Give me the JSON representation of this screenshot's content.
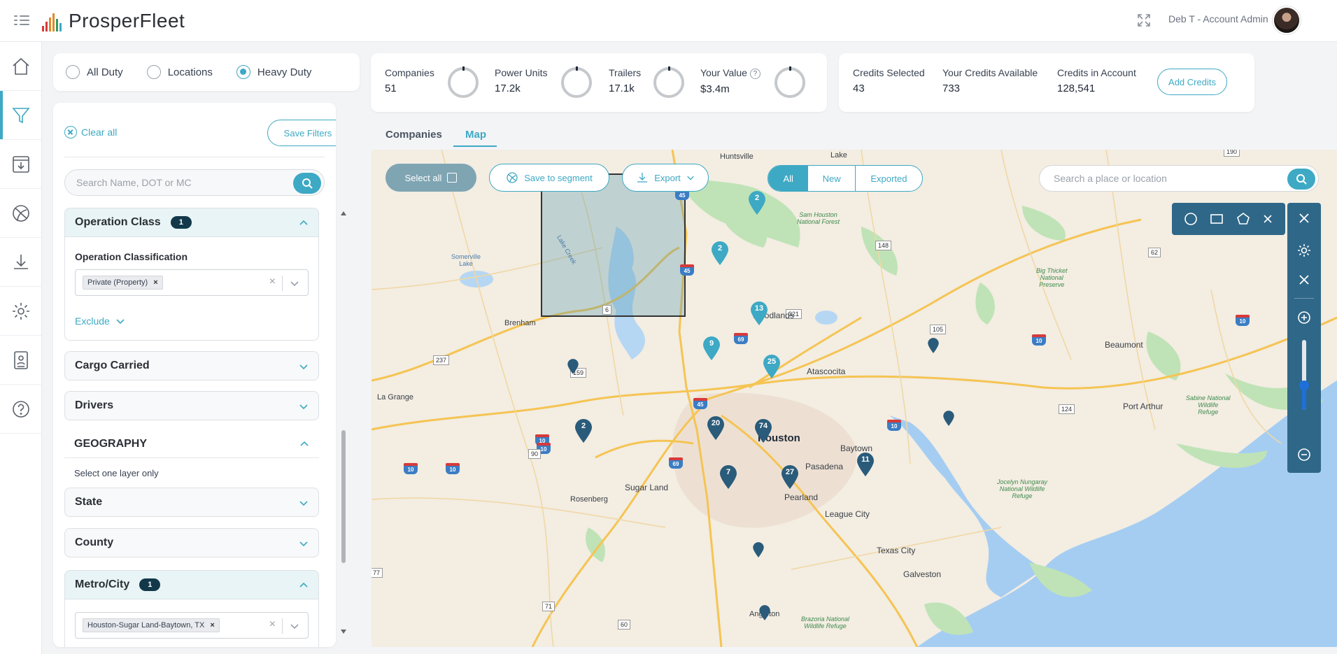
{
  "app": {
    "brand": "ProsperFleet",
    "account_label": "Deb T - Account Admin",
    "brand_colors": [
      "#d63a3a",
      "#e08a2a",
      "#3ea9c4",
      "#2f9d63"
    ]
  },
  "nav": {
    "items": [
      {
        "icon": "home-icon"
      },
      {
        "icon": "filter-icon",
        "active": true
      },
      {
        "icon": "save-download-icon"
      },
      {
        "icon": "segment-icon"
      },
      {
        "icon": "download-icon"
      },
      {
        "icon": "gear-icon"
      },
      {
        "icon": "contact-card-icon"
      },
      {
        "icon": "help-icon"
      }
    ]
  },
  "duty": {
    "options": [
      "All Duty",
      "Locations",
      "Heavy Duty"
    ],
    "selected": "Heavy Duty"
  },
  "stats": {
    "companies": {
      "label": "Companies",
      "value": "51"
    },
    "power_units": {
      "label": "Power Units",
      "value": "17.2k"
    },
    "trailers": {
      "label": "Trailers",
      "value": "17.1k"
    },
    "your_value": {
      "label": "Your Value",
      "value": "$3.4m",
      "help": "?"
    }
  },
  "credits": {
    "selected": {
      "label": "Credits Selected",
      "value": "43"
    },
    "available": {
      "label": "Your Credits Available",
      "value": "733"
    },
    "in_account": {
      "label": "Credits in Account",
      "value": "128,541"
    },
    "add_label": "Add Credits"
  },
  "filters": {
    "clear_all": "Clear all",
    "save_filters": "Save Filters",
    "search_placeholder": "Search Name, DOT or MC",
    "operation_class": {
      "title": "Operation Class",
      "badge": "1",
      "sub_label": "Operation Classification",
      "chip": "Private (Property)",
      "chip_remove": "×",
      "clear": "×",
      "exclude": "Exclude"
    },
    "cargo_carried": "Cargo Carried",
    "drivers": "Drivers",
    "geography": {
      "title": "GEOGRAPHY",
      "hint": "Select one layer only"
    },
    "state": "State",
    "county": "County",
    "metro": {
      "title": "Metro/City",
      "badge": "1",
      "chip": "Houston-Sugar Land-Baytown, TX",
      "chip_remove": "×",
      "clear": "×"
    }
  },
  "tabs": {
    "companies": "Companies",
    "map": "Map",
    "active": "Map"
  },
  "map": {
    "select_all": "Select all",
    "save_segment": "Save to segment",
    "export": "Export",
    "segments": [
      "All",
      "New",
      "Exported"
    ],
    "active_segment": "All",
    "search_placeholder": "Search a place or location",
    "clusters": [
      "2",
      "2",
      "13",
      "9",
      "25",
      "20",
      "74",
      "2",
      "7",
      "27",
      "11"
    ],
    "places": {
      "huntsville": "Huntsville",
      "lake": "Lake",
      "sam_houston": "Sam Houston\nNational Forest",
      "lake_creek": "Lake Creek",
      "somerville": "Somerville\nLake",
      "woodlands": "Woodlands",
      "brenham": "Brenham",
      "atascocita": "Atascocita",
      "big_thicket": "Big Thicket\nNational\nPreserve",
      "beaumont": "Beaumont",
      "la_grange": "La Grange",
      "houston": "Houston",
      "baytown": "Baytown",
      "port_arthur": "Port Arthur",
      "sabine": "Sabine National\nWildlife\nRefuge",
      "pasadena": "Pasadena",
      "sugar_land": "Sugar Land",
      "pearland": "Pearland",
      "rosenberg": "Rosenberg",
      "league_city": "League City",
      "jocelyn": "Jocelyn Nungaray\nNational Wildlife\nRefuge",
      "texas_city": "Texas City",
      "galveston": "Galveston",
      "angleton": "Angleton",
      "brazoria": "Brazoria National\nWildlife Refuge"
    },
    "shields": [
      "190",
      "148",
      "62",
      "12",
      "321",
      "105",
      "6",
      "237",
      "159",
      "90",
      "124",
      "71",
      "60",
      "77"
    ],
    "interstates": [
      "45",
      "45",
      "69",
      "10",
      "10",
      "10",
      "10",
      "10",
      "69",
      "45",
      "10",
      "10"
    ]
  }
}
